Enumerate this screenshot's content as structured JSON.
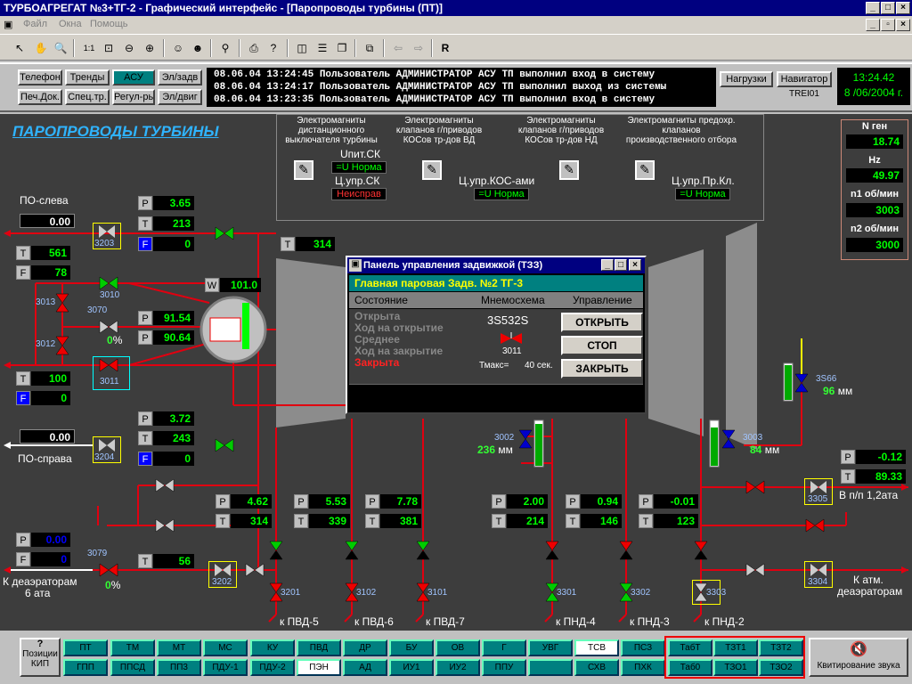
{
  "window": {
    "title": "ТУРБОАГРЕГАТ №3+ТГ-2 - Графический интерфейс - [Паропроводы турбины (ПТ)]"
  },
  "menu": [
    "Файл",
    "Окна",
    "Помощь"
  ],
  "topnav": {
    "row1": [
      "Телефон",
      "Тренды",
      "АСУ",
      "Эл/задв"
    ],
    "row2": [
      "Печ.Док.",
      "Спец.тр.",
      "Регул-ры",
      "Эл/двиг"
    ],
    "right": [
      "Нагрузки",
      "Навигатор"
    ],
    "station": "TREI01"
  },
  "log": [
    "08.06.04 13:24:45  Пользователь АДМИНИСТРАТОР АСУ ТП выполнил вход в систему",
    "08.06.04 13:24:17  Пользователь АДМИНИСТРАТОР АСУ ТП выполнил выход из системы",
    "08.06.04 13:23:35  Пользователь АДМИНИСТРАТОР АСУ ТП выполнил вход в систему"
  ],
  "clock": {
    "time": "13:24.42",
    "date": "8 /06/2004 г."
  },
  "screen_title": "ПАРОПРОВОДЫ  ТУРБИНЫ",
  "em": {
    "h1": "Электромагниты дистанционного выключателя турбины",
    "h2": "Электромагниты клапанов г/приводов КОСов тр-дов ВД",
    "h3": "Электромагниты клапанов г/приводов КОСов тр-дов НД",
    "h4": "Электромагниты предохр. клапанов производственного отбора",
    "upit": "Uпит.СК",
    "upit_v": "=U Норма",
    "cupr": "Ц.упр.СК",
    "cupr_v": "Неисправ",
    "kos": "Ц.упр.КОС-ами",
    "kos_v": "=U Норма",
    "prkl": "Ц.упр.Пр.Кл.",
    "prkl_v": "=U Норма"
  },
  "right_panel": [
    {
      "label": "N ген",
      "value": "18.74"
    },
    {
      "label": "Hz",
      "value": "49.97"
    },
    {
      "label": "n1 об/мин",
      "value": "3003"
    },
    {
      "label": "n2 об/мин",
      "value": "3000"
    }
  ],
  "po_left": {
    "label": "ПО-слева",
    "value": "0.00",
    "T": "561",
    "F": "78"
  },
  "po_right": {
    "label": "ПО-справа",
    "value": "0.00"
  },
  "v3203": {
    "P": "3.65",
    "T": "213",
    "F": "0"
  },
  "v3204": {
    "P": "3.72",
    "T": "243",
    "F": "0"
  },
  "t_top": "314",
  "w": "101.0",
  "p1": "91.54",
  "p2": "90.64",
  "v3011": {
    "T": "100",
    "F": "0"
  },
  "pct3070": "0",
  "deaer": {
    "P": "0.00",
    "F": "0",
    "label1": "К деаэраторам",
    "label2": "6 ата",
    "pct": "0",
    "T": "56"
  },
  "pvd": [
    {
      "P": "4.62",
      "T": "314",
      "tag": "3201",
      "label": "к ПВД-5"
    },
    {
      "P": "5.53",
      "T": "339",
      "tag": "3102",
      "label": "к ПВД-6"
    },
    {
      "P": "7.78",
      "T": "381",
      "tag": "3101",
      "label": "к ПВД-7"
    }
  ],
  "pnd": [
    {
      "P": "2.00",
      "T": "214",
      "tag": "3301",
      "label": "к ПНД-4"
    },
    {
      "P": "0.94",
      "T": "146",
      "tag": "3302",
      "label": "к ПНД-3"
    },
    {
      "P": "-0.01",
      "T": "123",
      "tag": "3303",
      "label": "к ПНД-2"
    }
  ],
  "v3002": {
    "tag": "3002",
    "mm": "236"
  },
  "v3003": {
    "tag": "3003",
    "mm": "84"
  },
  "v3s66": {
    "tag": "3S66",
    "mm": "96"
  },
  "right_pt": {
    "P": "-0.12",
    "T": "89.33",
    "label": "В п/п 1,2ата",
    "atm1": "К атм.",
    "atm2": "деаэраторам"
  },
  "tags": {
    "t3203": "3203",
    "t3204": "3204",
    "t3010": "3010",
    "t3013": "3013",
    "t3070": "3070",
    "t3012": "3012",
    "t3011": "3011",
    "t3079": "3079",
    "t3202": "3202",
    "t3305": "3305",
    "t3304": "3304"
  },
  "units": {
    "mm": "мм",
    "pct": "%",
    "W": "W",
    "P": "P",
    "T": "T",
    "F": "F"
  },
  "dialog": {
    "title": "Панель управления задвижкой (ТЗЗ)",
    "subtitle": "Главная паровая Задв. №2 ТГ-3",
    "col1": "Состояние",
    "col2": "Мнемосхема",
    "col3": "Управление",
    "states": [
      "Открыта",
      "Ход на открытие",
      "Среднее",
      "Ход на закрытие",
      "Закрыта"
    ],
    "code": "3S532S",
    "valve_tag": "3011",
    "tmax_label": "Тмакс=",
    "tmax": "40 сек.",
    "btn_open": "ОТКРЫТЬ",
    "btn_stop": "СТОП",
    "btn_close": "ЗАКРЫТЬ"
  },
  "bottom": {
    "left_label": "Позиции КИП",
    "left_icon": "?",
    "row1": [
      "ПТ",
      "ТМ",
      "МТ",
      "МС",
      "КУ",
      "ПВД",
      "ДР",
      "БУ",
      "ОВ",
      "Г",
      "УВГ",
      "ТСВ",
      "ПСЗ"
    ],
    "row2": [
      "ГПП",
      "ППСД",
      "ПП3",
      "ПДУ-1",
      "ПДУ-2",
      "ПЭН",
      "АД",
      "ИУ1",
      "ИУ2",
      "ППУ",
      "",
      "СХВ",
      "ПХК"
    ],
    "red_row1": [
      "ТабТ",
      "ТЗТ1",
      "ТЗТ2"
    ],
    "red_row2": [
      "Таб0",
      "ТЗО1",
      "ТЗО2"
    ],
    "sound": "Квитирование звука"
  }
}
